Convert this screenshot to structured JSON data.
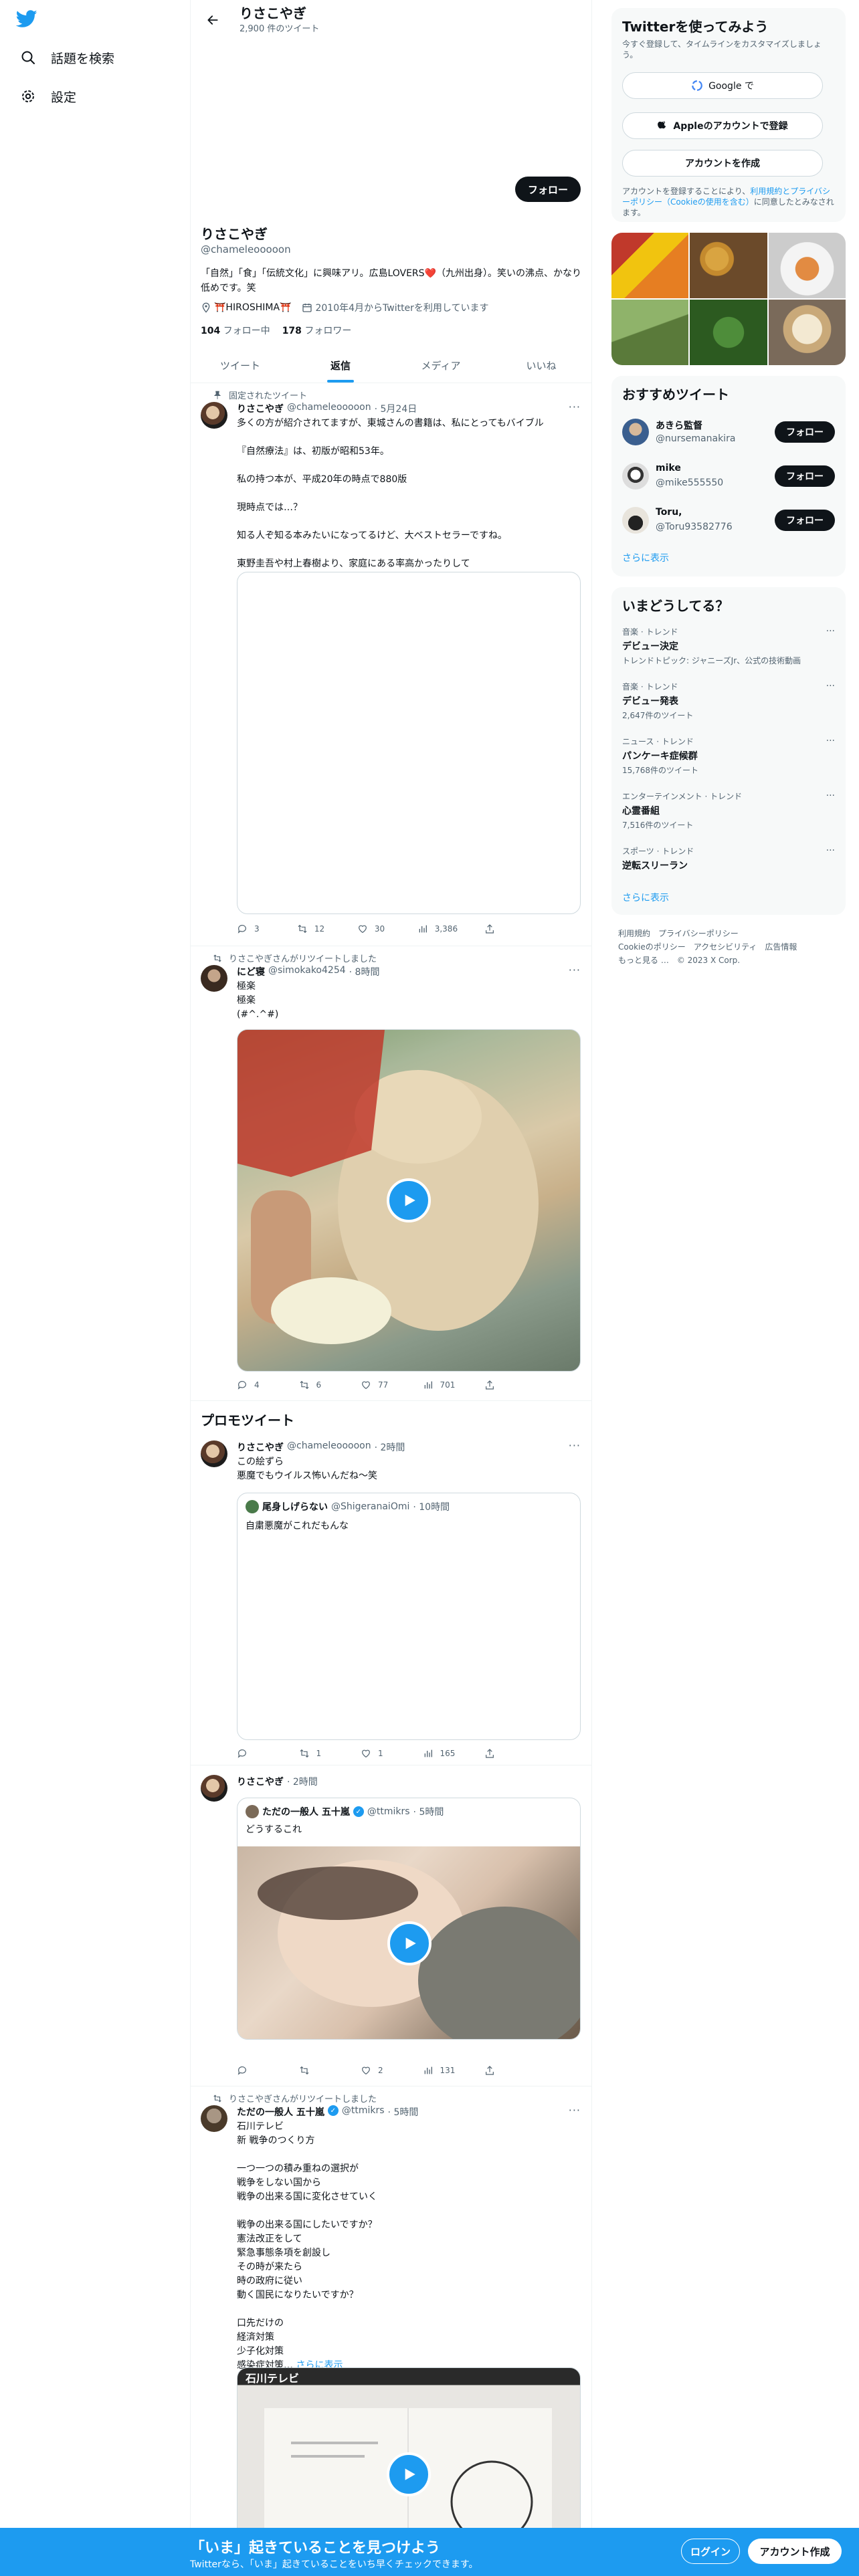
{
  "nav": {
    "explore": "話題を検索",
    "settings": "設定"
  },
  "header": {
    "title": "りさこやぎ",
    "tweet_count": "2,900 件のツイート"
  },
  "profile": {
    "follow": "フォロー",
    "name": "りさこやぎ",
    "handle": "@chameleooooon",
    "bio": "「自然」「食」「伝統文化」に興味アリ。広島LOVERS❤️（九州出身）。笑いの沸点、かなり低めです。笑",
    "location": "⛩️HIROSHIMA⛩️",
    "joined": "2010年4月からTwitterを利用しています",
    "following_count": "104",
    "following_label": "フォロー中",
    "followers_count": "178",
    "followers_label": "フォロワー"
  },
  "tabs": [
    "ツイート",
    "返信",
    "メディア",
    "いいね"
  ],
  "tweets": {
    "t1": {
      "pinned": "固定されたツイート",
      "name": "りさこやぎ",
      "handle": "@chameleooooon",
      "time": "· 5月24日",
      "text": "多くの方が紹介されてますが、東城さんの書籍は、私にとってもバイブル\n\n『自然療法』は、初版が昭和53年。\n\n私の持つ本が、平成20年の時点で880版\n\n現時点では…？\n\n知る人ぞ知る本みたいになってるけど、大ベストセラーですね。\n\n東野圭吾や村上春樹より、家庭にある率高かったりして",
      "replies": "3",
      "retweets": "12",
      "likes": "30",
      "views": "3,386"
    },
    "t2": {
      "rt": "りさこやぎさんがリツイートしました",
      "name": "にど寝",
      "handle": "@simokako4254",
      "time": "· 8時間",
      "text": "極楽\n極楽\n(#^.^#)",
      "replies": "4",
      "retweets": "6",
      "likes": "77",
      "views": "701"
    },
    "promo_heading": "プロモツイート",
    "t3": {
      "name": "りさこやぎ",
      "handle": "@chameleooooon",
      "time": "· 2時間",
      "text": "この絵ずら\n悪魔でもウイルス怖いんだね〜笑",
      "quote_name": "尾身しげらない",
      "quote_handle": "@ShigeranaiOmi",
      "quote_time": "· 10時間",
      "quote_text": "自粛悪魔がこれだもんな",
      "replies": "",
      "retweets": "1",
      "likes": "1",
      "views": "165"
    },
    "t4": {
      "name": "りさこやぎ",
      "handle": "@chameleooooon",
      "time": "· 2時間",
      "quote_name": "ただの一般人 五十嵐",
      "quote_handle": "@ttmikrs",
      "quote_time": "· 5時間",
      "quote_text": "どうするこれ",
      "replies": "",
      "retweets": "",
      "likes": "2",
      "views": "131"
    },
    "t5": {
      "rt": "りさこやぎさんがリツイートしました",
      "name": "ただの一般人 五十嵐",
      "handle": "@ttmikrs",
      "time": "· 5時間",
      "text": "石川テレビ\n新 戦争のつくり方\n\n一つ一つの積み重ねの選択が\n戦争をしない国から\n戦争の出来る国に変化させていく\n\n戦争の出来る国にしたいですか？\n憲法改正をして\n緊急事態条項を創設し\nその時が来たら\n時の政府に従い\n動く国民になりたいですか？\n\n口先だけの\n経済対策\n少子化対策\n感染症対策…",
      "more": "さらに表示",
      "media_caption": "石川テレビ"
    }
  },
  "right": {
    "signup": {
      "title": "Twitterを使ってみよう",
      "sub": "今すぐ登録して、タイムラインをカスタマイズしましょう。",
      "google": "Google で",
      "apple": "Appleのアカウントで登録",
      "create": "アカウントを作成",
      "terms_pre": "アカウントを登録することにより、",
      "terms_link": "利用規約とプライバシーポリシー（Cookieの使用を含む）",
      "terms_post": "に同意したとみなされます。"
    },
    "recommended": {
      "title": "おすすめツイート",
      "users": [
        {
          "name": "あきら監督",
          "handle": "@nursemanakira",
          "btn": "フォロー"
        },
        {
          "name": "mike",
          "handle": "@mike555550",
          "btn": "フォロー"
        },
        {
          "name": "Toru,",
          "handle": "@Toru93582776",
          "btn": "フォロー"
        }
      ],
      "more": "さらに表示"
    },
    "trends": {
      "title": "いまどうしてる？",
      "items": [
        {
          "cat": "音楽 · トレンド",
          "title": "デビュー決定",
          "count": "トレンドトピック: ジャニーズJr、公式の技術動画"
        },
        {
          "cat": "音楽 · トレンド",
          "title": "デビュー発表",
          "count": "2,647件のツイート"
        },
        {
          "cat": "ニュース · トレンド",
          "title": "パンケーキ症候群",
          "count": "15,768件のツイート"
        },
        {
          "cat": "エンターテインメント · トレンド",
          "title": "心霊番組",
          "count": "7,516件のツイート"
        },
        {
          "cat": "スポーツ · トレンド",
          "title": "逆転スリーラン",
          "count": ""
        }
      ],
      "more": "さらに表示"
    },
    "footer": {
      "line1": "利用規約　プライバシーポリシー",
      "line2": "Cookieのポリシー　アクセシビリティ　広告情報",
      "line3": "もっと見る …　© 2023 X Corp."
    }
  },
  "banner": {
    "title": "「いま」起きていることを見つけよう",
    "sub": "Twitterなら、「いま」起きていることをいち早くチェックできます。",
    "login": "ログイン",
    "signup": "アカウント作成"
  },
  "colors": {
    "accent": "#1d9bf0",
    "text": "#0f1419",
    "muted": "#536471",
    "border": "#eff3f4"
  }
}
